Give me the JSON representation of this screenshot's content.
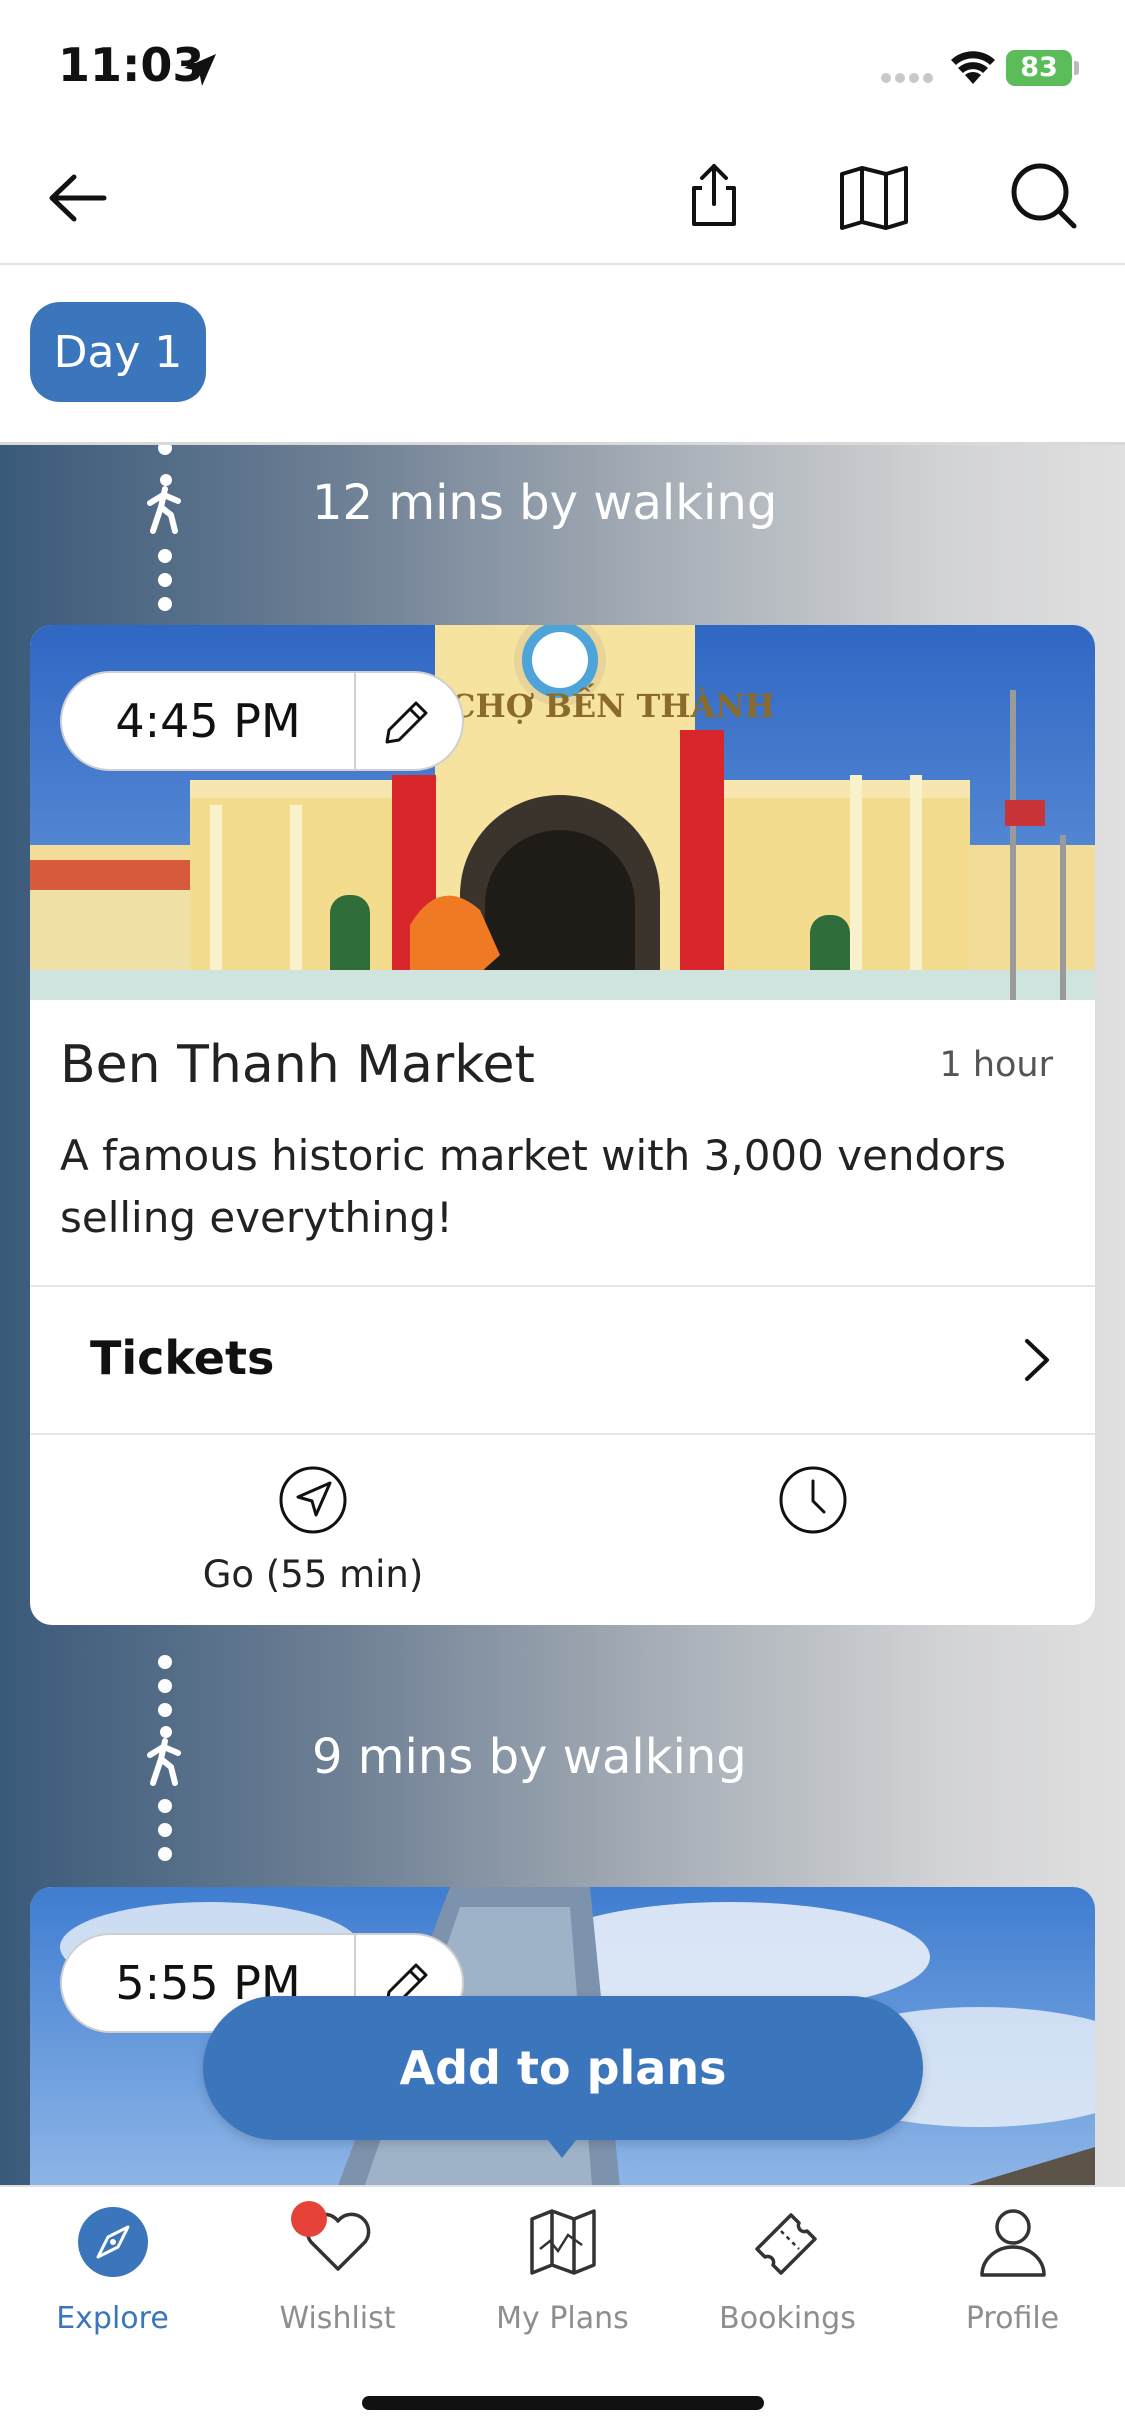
{
  "status_bar": {
    "time": "11:03",
    "battery": "83"
  },
  "header": {
    "icons": [
      "back-arrow-icon",
      "share-icon",
      "map-icon",
      "search-icon"
    ]
  },
  "day_tabs": [
    {
      "label": "Day 1",
      "selected": true
    }
  ],
  "itinerary": {
    "travel_1": "12 mins by walking",
    "stop_1": {
      "time": "4:45 PM",
      "title": "Ben Thanh Market",
      "duration": "1 hour",
      "description": "A famous historic market with 3,000 vendors selling everything!",
      "tickets_label": "Tickets",
      "go_label": "Go (55 min)"
    },
    "travel_2": "9 mins by walking",
    "stop_2": {
      "time": "5:55 PM"
    }
  },
  "add_to_plans_label": "Add to plans",
  "tab_bar": {
    "explore": "Explore",
    "wishlist": "Wishlist",
    "my_plans": "My Plans",
    "bookings": "Bookings",
    "profile": "Profile"
  },
  "colors": {
    "accent": "#3b76bd",
    "badge": "#e6423a",
    "battery": "#5bbd5a"
  }
}
